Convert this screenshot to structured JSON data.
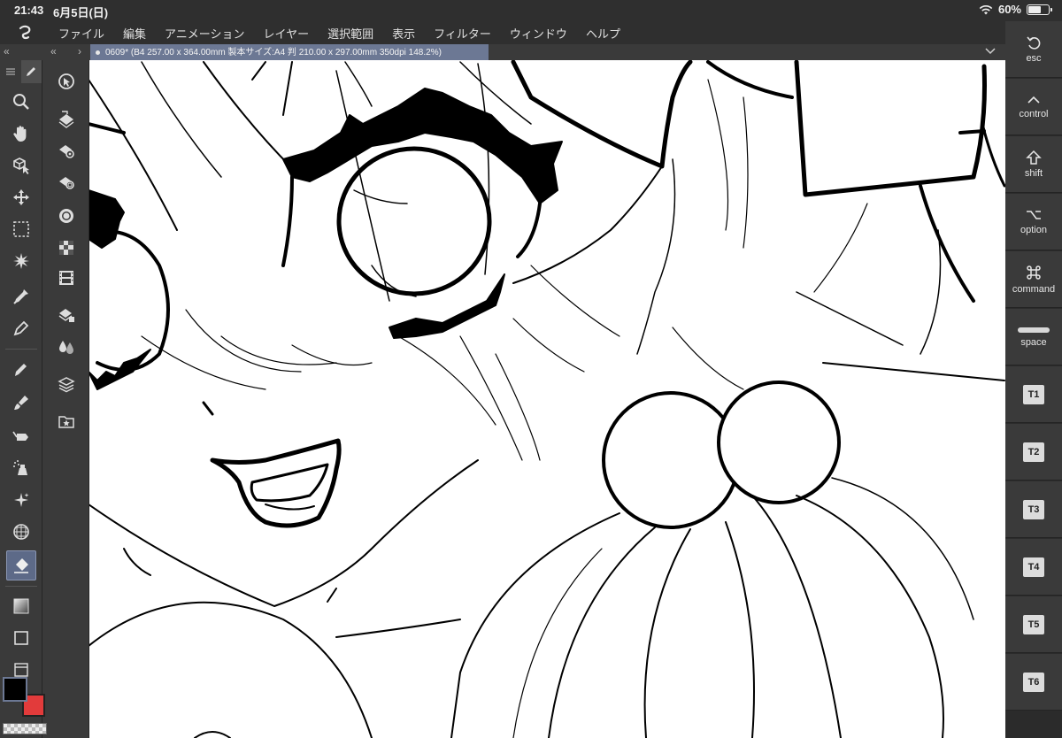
{
  "status": {
    "time": "21:43",
    "date": "6月5日(日)",
    "battery": "60%",
    "battery_level": 0.6
  },
  "menu": [
    "ファイル",
    "編集",
    "アニメーション",
    "レイヤー",
    "選択範囲",
    "表示",
    "フィルター",
    "ウィンドウ",
    "ヘルプ"
  ],
  "tab": {
    "title": "0609* (B4 257.00 x 364.00mm 製本サイズ:A4 判 210.00 x 297.00mm 350dpi 148.2%)",
    "collapse_left": "«",
    "collapse_mid": "«",
    "expand_mid": "›"
  },
  "tools": [
    "zoom-icon",
    "hand-icon",
    "operation-icon",
    "move-icon",
    "selection-icon",
    "auto-select-icon",
    "eyedropper-icon",
    "pen-icon",
    "pencil-icon",
    "brush-icon",
    "airbrush-icon",
    "decoration-icon",
    "sparkle-icon",
    "figure-icon",
    "eraser-icon",
    "gradient-icon",
    "frame-icon",
    "text-icon"
  ],
  "subtools": [
    "layer-select-icon",
    "layer-fill-icon",
    "layer-settings-icon",
    "layer-mask-icon",
    "circle-layer-icon",
    "tone-layer-icon",
    "film-layer-icon",
    "layer-stack-icon",
    "ink-icon",
    "layers-icon",
    "material-icon"
  ],
  "colors": {
    "main": "#000000",
    "sub": "#e23b3b",
    "accent": "#6c7894"
  },
  "edge_keys": [
    {
      "label": "esc",
      "icon": "undo-icon"
    },
    {
      "label": "control",
      "icon": "caret-up-icon"
    },
    {
      "label": "shift",
      "icon": "shift-arrow-icon"
    },
    {
      "label": "option",
      "icon": "option-key-icon"
    },
    {
      "label": "command",
      "icon": "command-key-icon"
    },
    {
      "label": "space",
      "icon": "spacebar-icon"
    },
    {
      "label": "T1",
      "icon": ""
    },
    {
      "label": "T2",
      "icon": ""
    },
    {
      "label": "T3",
      "icon": ""
    },
    {
      "label": "T4",
      "icon": ""
    },
    {
      "label": "T5",
      "icon": ""
    },
    {
      "label": "T6",
      "icon": ""
    }
  ]
}
